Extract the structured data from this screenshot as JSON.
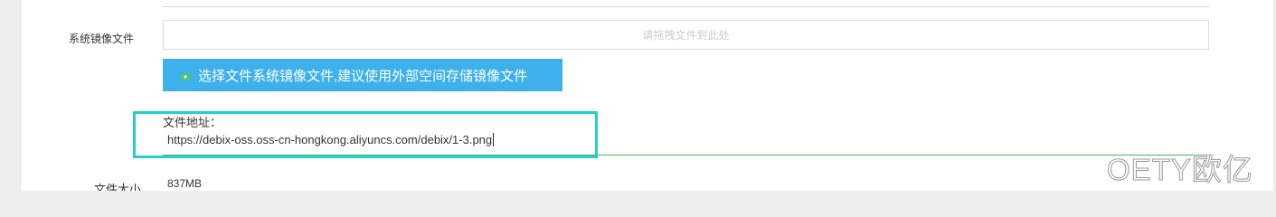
{
  "form": {
    "image_file_label": "系统镜像文件",
    "drop_zone_placeholder": "请拖拽文件到此处",
    "select_button_label": "选择文件系统镜像文件,建议使用外部空间存储镜像文件",
    "file_address_label": "文件地址：",
    "file_address_value": "https://debix-oss.oss-cn-hongkong.aliyuncs.com/debix/1-3.png",
    "file_size_label": "文件大小",
    "file_size_value": "837MB"
  },
  "watermark": {
    "text": "OETY欧亿"
  },
  "colors": {
    "button_bg": "#3eb1ec",
    "highlight_border": "#25cfcf",
    "underline_green": "#4cb84c",
    "cloud_icon": "#52c47a"
  },
  "icons": {
    "upload": "cloud-upload-icon"
  }
}
